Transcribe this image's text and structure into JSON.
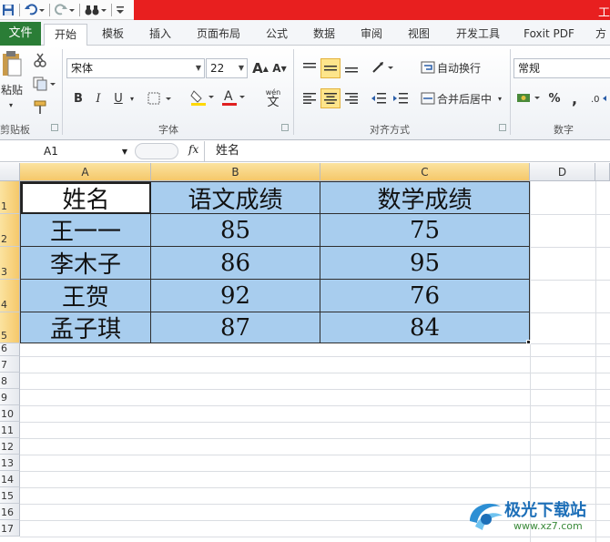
{
  "qat": {
    "save_icon": "save-icon",
    "undo_icon": "undo-icon",
    "redo_icon": "redo-icon",
    "find_icon": "binoculars-icon"
  },
  "window": {
    "title_partial": "工",
    "title_bar_color": "#e81f1f"
  },
  "tabs": [
    {
      "label": "文件"
    },
    {
      "label": "开始"
    },
    {
      "label": "模板"
    },
    {
      "label": "插入"
    },
    {
      "label": "页面布局"
    },
    {
      "label": "公式"
    },
    {
      "label": "数据"
    },
    {
      "label": "审阅"
    },
    {
      "label": "视图"
    },
    {
      "label": "开发工具"
    },
    {
      "label": "Foxit PDF"
    },
    {
      "label": "方"
    }
  ],
  "ribbon": {
    "clipboard": {
      "paste_label": "粘贴",
      "group_label": "剪贴板"
    },
    "font": {
      "font_name": "宋体",
      "font_size": "22",
      "group_label": "字体",
      "bold": "B",
      "italic": "I",
      "underline": "U",
      "grow": "A",
      "shrink": "A",
      "wen": "wén",
      "wen_char": "文"
    },
    "alignment": {
      "wrap_label": "自动换行",
      "merge_label": "合并后居中",
      "group_label": "对齐方式"
    },
    "number": {
      "format": "常规",
      "group_label": "数字",
      "percent": "%",
      "comma": ","
    }
  },
  "formula_bar": {
    "name_box": "A1",
    "fx": "fx",
    "content": "姓名"
  },
  "grid": {
    "columns": [
      "A",
      "B",
      "C",
      "D"
    ],
    "rows": [
      "1",
      "2",
      "3",
      "4",
      "5",
      "6",
      "7",
      "8",
      "9",
      "10",
      "11",
      "12",
      "13",
      "14",
      "15",
      "16",
      "17"
    ],
    "header_row": [
      "姓名",
      "语文成绩",
      "数学成绩"
    ],
    "data_rows": [
      [
        "王一一",
        "85",
        "75"
      ],
      [
        "李木子",
        "86",
        "95"
      ],
      [
        "王贺",
        "92",
        "76"
      ],
      [
        "孟子琪",
        "87",
        "84"
      ]
    ],
    "fill_color": "#a8cdee"
  },
  "watermark": {
    "text": "极光下载站",
    "url": "www.xz7.com"
  }
}
